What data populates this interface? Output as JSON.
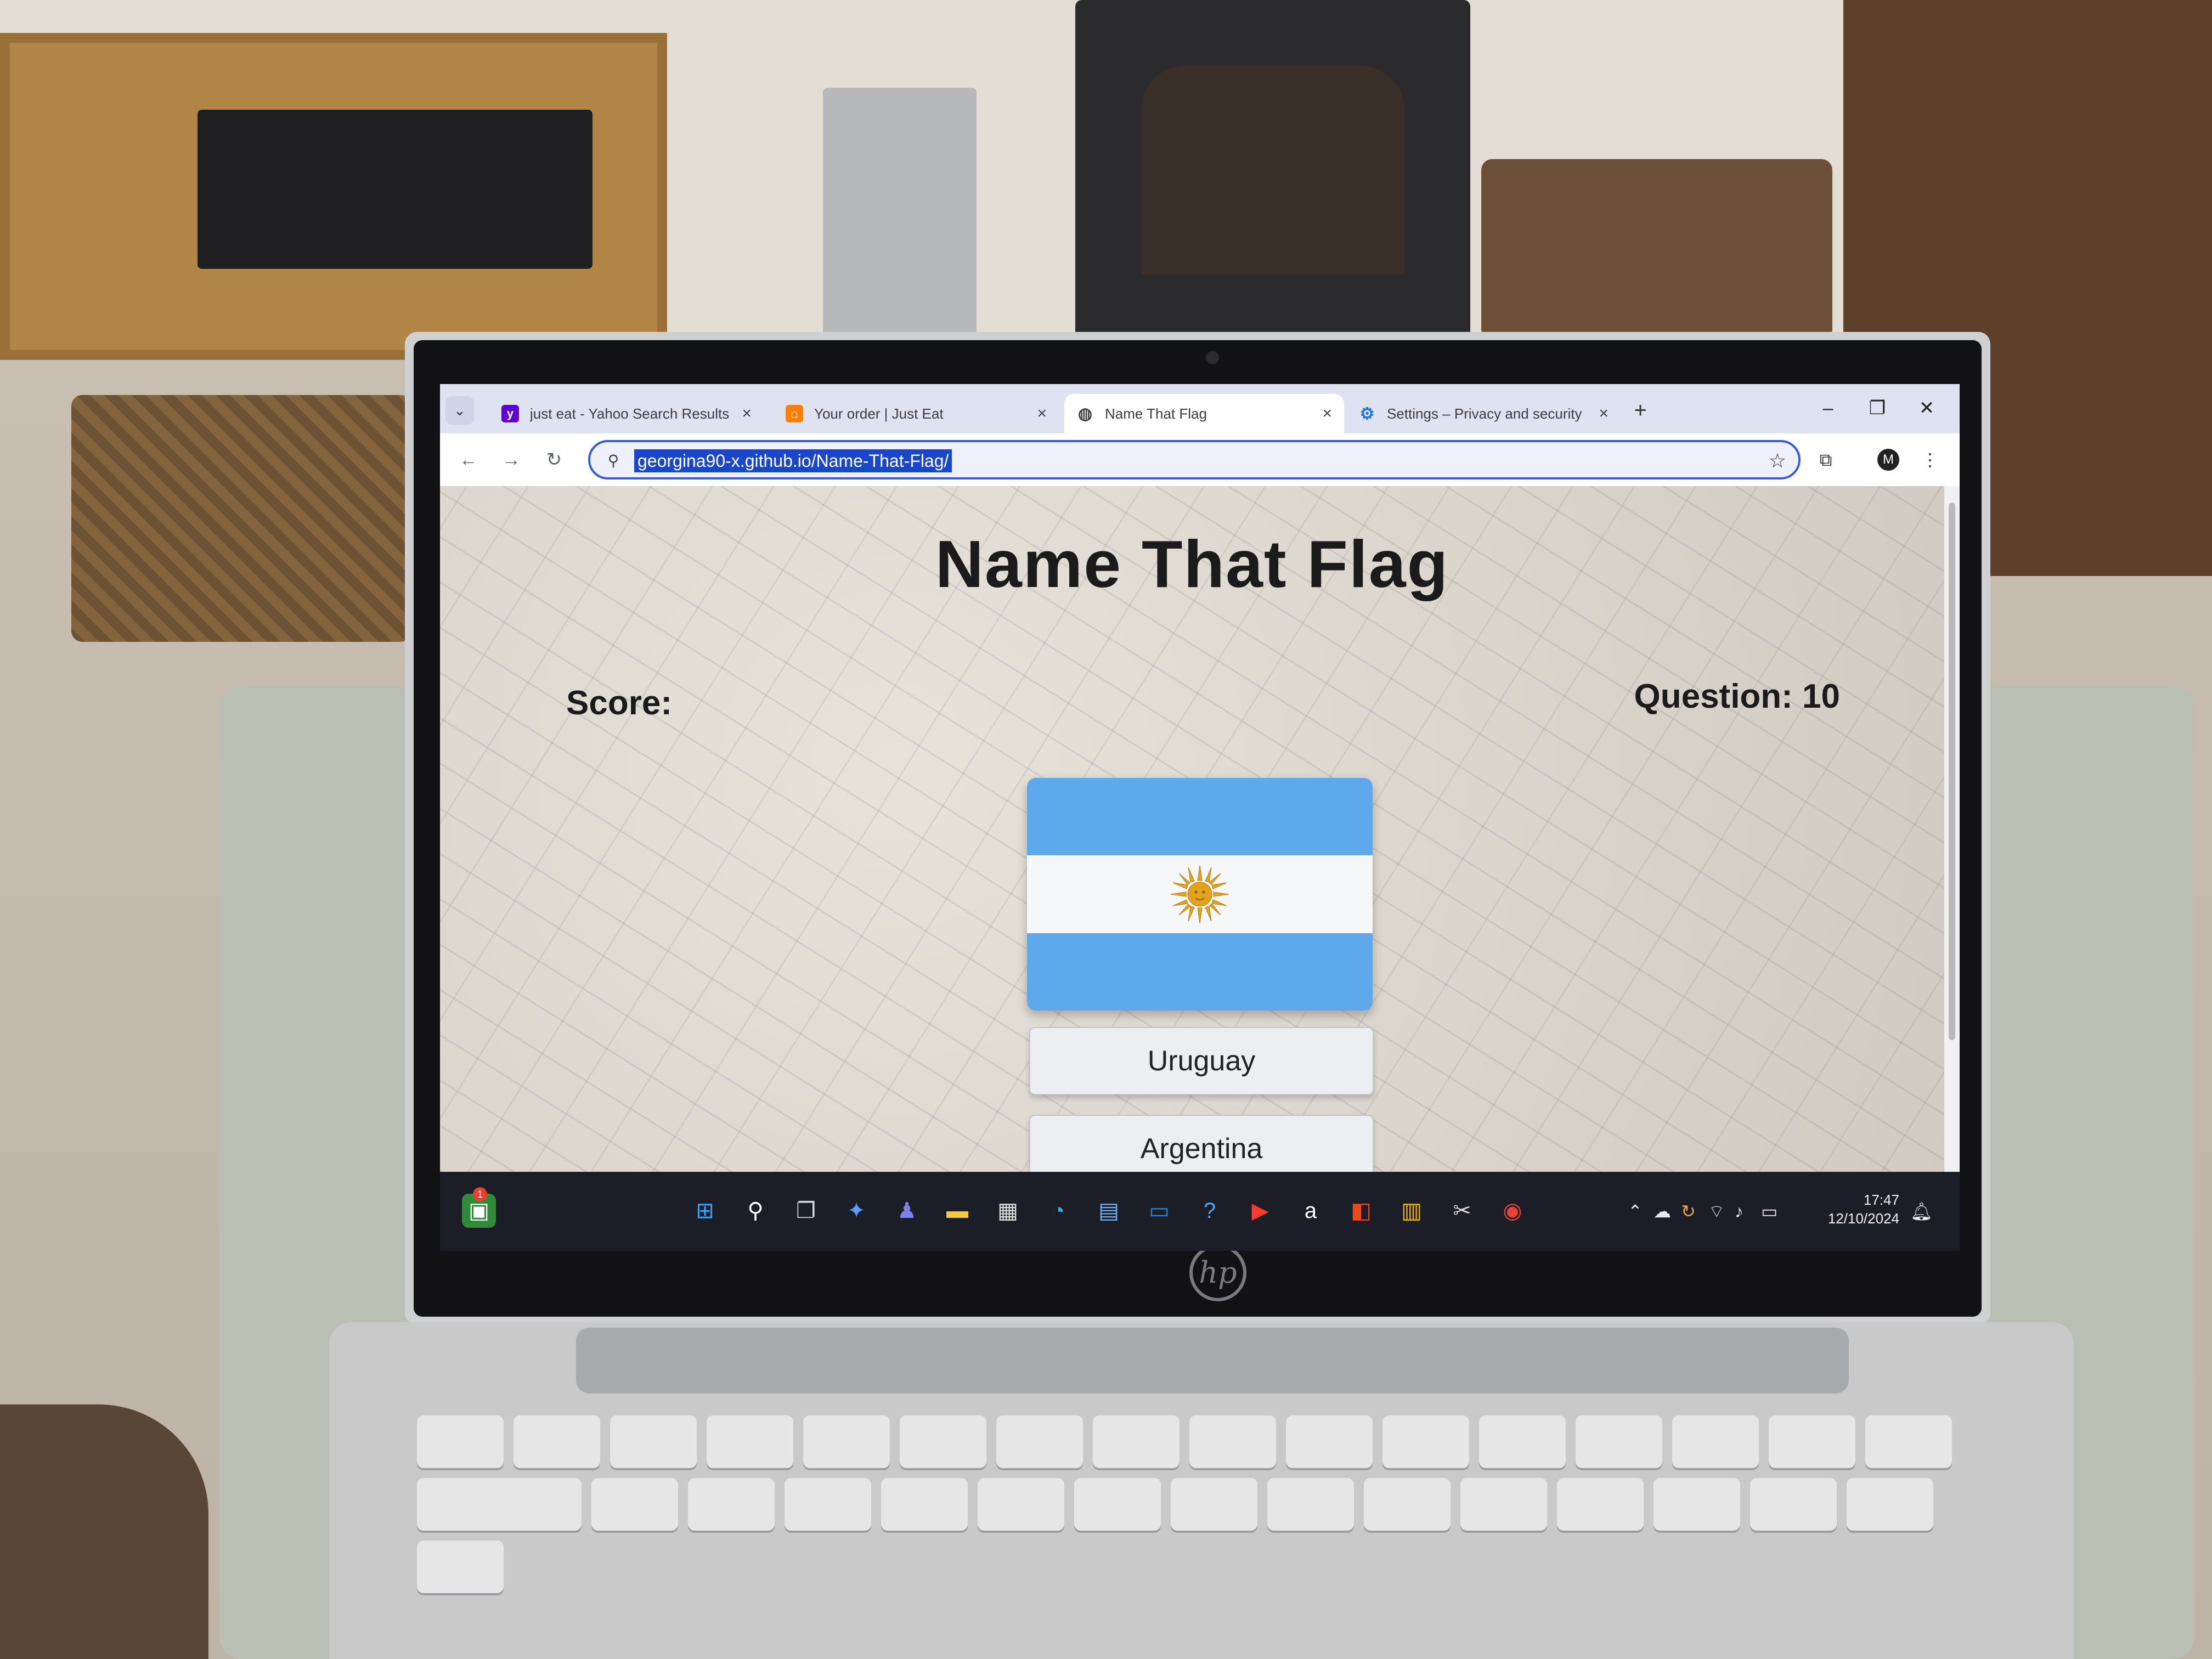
{
  "browser": {
    "tabs": [
      {
        "title": "just eat - Yahoo Search Results",
        "favicon": "yahoo-icon",
        "favicon_color": "#5f01d1",
        "active": false
      },
      {
        "title": "Your order | Just Eat",
        "favicon": "just-eat-icon",
        "favicon_color": "#ff8000",
        "active": false
      },
      {
        "title": "Name That Flag",
        "favicon": "globe-icon",
        "favicon_color": "#444444",
        "active": true
      },
      {
        "title": "Settings – Privacy and security",
        "favicon": "gear-icon",
        "favicon_color": "#1a73e8",
        "active": false
      }
    ],
    "url": "georgina90-x.github.io/Name-That-Flag/",
    "profile_initial": "M"
  },
  "page": {
    "title": "Name That Flag",
    "score_label": "Score:",
    "question_label": "Question: 10",
    "flag": {
      "country_icon": "argentina-flag",
      "colors": {
        "blue": "#5ea8ec",
        "white": "#f6f7f9",
        "sun": "#e2a21c"
      }
    },
    "answers": [
      "Uruguay",
      "Argentina"
    ]
  },
  "taskbar": {
    "notification_count": "1",
    "time": "17:47",
    "date": "12/10/2024"
  },
  "device": {
    "brand": "hp"
  }
}
